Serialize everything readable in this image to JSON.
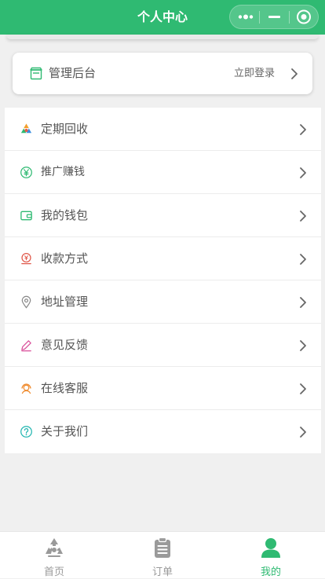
{
  "header": {
    "title": "个人中心"
  },
  "admin": {
    "label": "管理后台",
    "action": "立即登录"
  },
  "menu": {
    "items": [
      {
        "label": "定期回收",
        "icon": "recycle-icon"
      },
      {
        "label": " 推广赚钱",
        "icon": "yen-icon"
      },
      {
        "label": "我的钱包",
        "icon": "wallet-icon"
      },
      {
        "label": "收款方式",
        "icon": "payment-icon"
      },
      {
        "label": "地址管理",
        "icon": "location-icon"
      },
      {
        "label": "意见反馈",
        "icon": "pencil-icon"
      },
      {
        "label": "在线客服",
        "icon": "headset-icon"
      },
      {
        "label": "关于我们",
        "icon": "question-icon"
      }
    ]
  },
  "tabbar": {
    "tabs": [
      {
        "label": "首页",
        "icon": "recycle-icon",
        "active": false
      },
      {
        "label": "订单",
        "icon": "clipboard-icon",
        "active": false
      },
      {
        "label": "我的",
        "icon": "user-icon",
        "active": true
      }
    ]
  },
  "colors": {
    "brand": "#2fba72",
    "inactive_tab": "#9a9a9a"
  }
}
